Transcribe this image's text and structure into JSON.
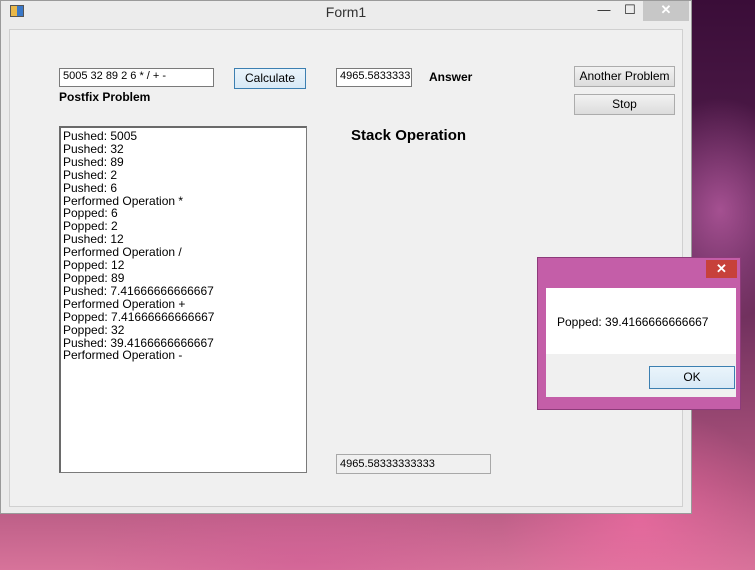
{
  "window": {
    "title": "Form1",
    "minimize_glyph": "—",
    "maximize_glyph": "☐",
    "close_glyph": "✕"
  },
  "form": {
    "problem_input_value": "5005 32 89 2 6 * / + -",
    "calculate_label": "Calculate",
    "postfix_label": "Postfix Problem",
    "answer_value": "4965.5833333",
    "answer_label": "Answer",
    "another_problem_label": "Another Problem",
    "stop_label": "Stop",
    "stack_operation_heading": "Stack Operation",
    "bottom_value": "4965.58333333333"
  },
  "log": [
    "Pushed: 5005",
    "Pushed: 32",
    "Pushed: 89",
    "Pushed: 2",
    "Pushed: 6",
    "Performed Operation *",
    "Popped: 6",
    "Popped: 2",
    "Pushed: 12",
    "Performed Operation /",
    "Popped: 12",
    "Popped: 89",
    "Pushed: 7.41666666666667",
    "Performed Operation +",
    "Popped: 7.41666666666667",
    "Popped: 32",
    "Pushed: 39.4166666666667",
    "Performed Operation -"
  ],
  "dialog": {
    "close_glyph": "✕",
    "message": "Popped: 39.4166666666667",
    "ok_label": "OK"
  }
}
